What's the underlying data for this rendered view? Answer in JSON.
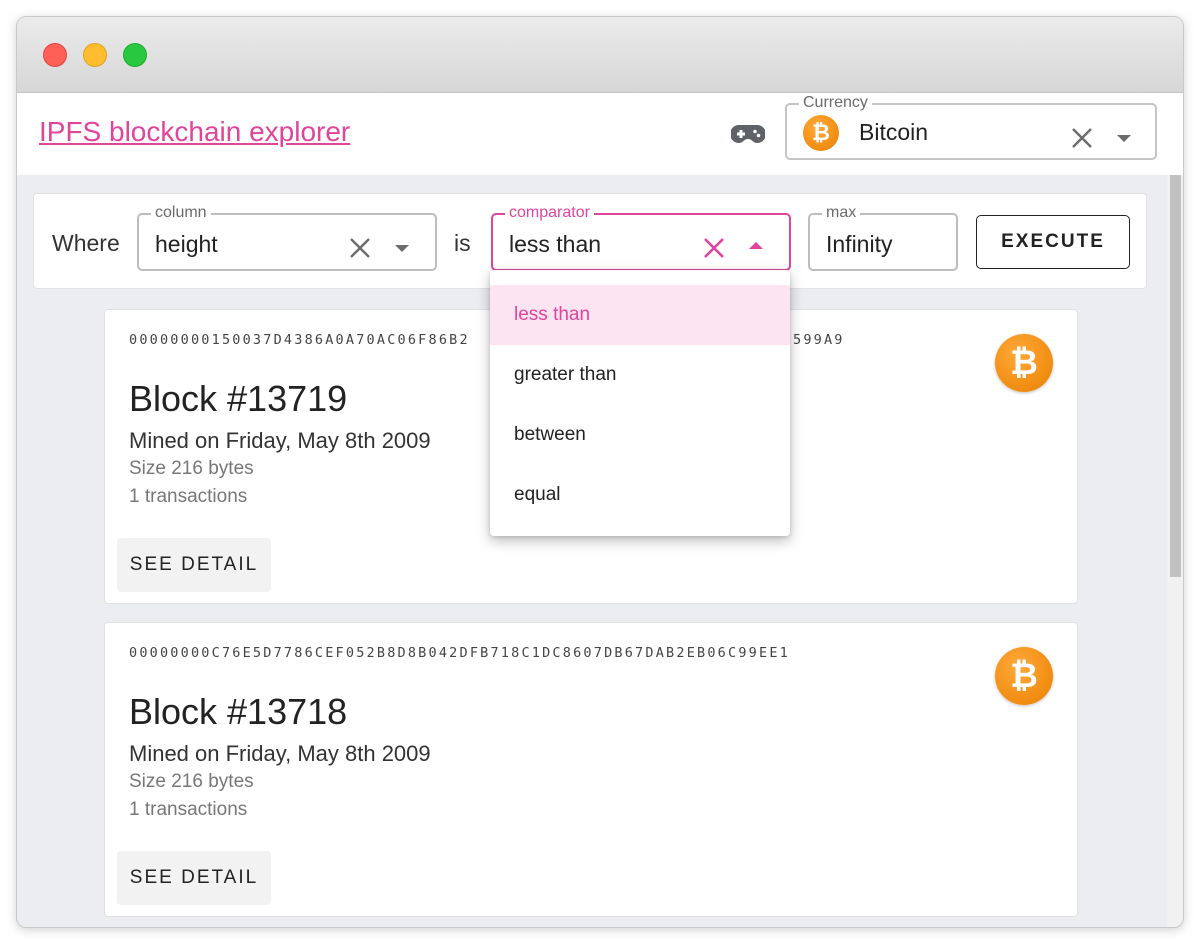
{
  "window": {
    "traffic_lights": [
      "close",
      "minimize",
      "maximize"
    ]
  },
  "appbar": {
    "title": "IPFS blockchain explorer",
    "gamepad_icon": "gamepad-icon",
    "currency": {
      "label": "Currency",
      "value": "Bitcoin",
      "icon": "bitcoin-icon"
    }
  },
  "filter": {
    "where_label": "Where",
    "column": {
      "label": "column",
      "value": "height"
    },
    "is_label": "is",
    "comparator": {
      "label": "comparator",
      "value": "less than"
    },
    "max": {
      "label": "max",
      "value": "Infinity"
    },
    "execute_label": "EXECUTE"
  },
  "comparator_menu": {
    "options": [
      "less than",
      "greater than",
      "between",
      "equal"
    ],
    "selected": "less than"
  },
  "blocks": [
    {
      "hash_start": "00000000150037D4386A0A70AC06F86B2",
      "hash_end": "599A9",
      "title": "Block #13719",
      "mined": "Mined on Friday, May 8th 2009",
      "size": "Size 216 bytes",
      "transactions": "1 transactions",
      "button": "SEE DETAIL"
    },
    {
      "hash": "00000000C76E5D7786CEF052B8D8B042DFB718C1DC8607DB67DAB2EB06C99EE1",
      "title": "Block #13718",
      "mined": "Mined on Friday, May 8th 2009",
      "size": "Size 216 bytes",
      "transactions": "1 transactions",
      "button": "SEE DETAIL"
    }
  ],
  "colors": {
    "accent": "#e0449b",
    "bitcoin": "#f7931a",
    "background": "#ebedf0"
  }
}
